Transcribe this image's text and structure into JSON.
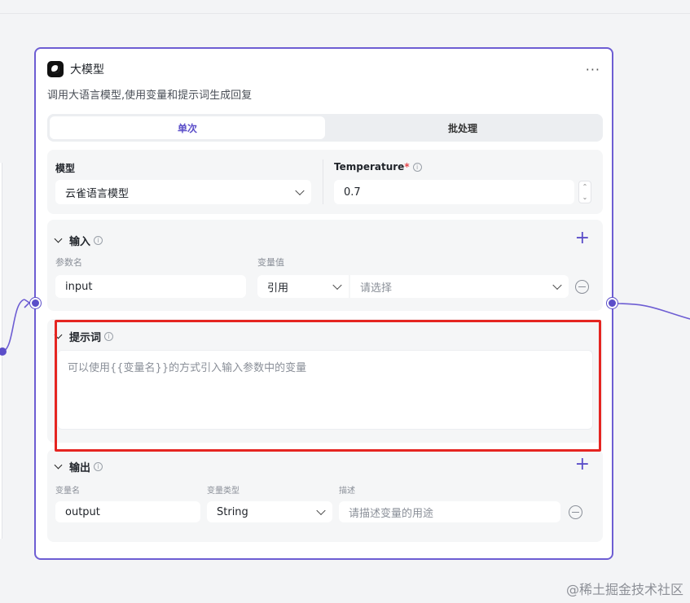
{
  "node": {
    "title": "大模型",
    "more_label": "···",
    "description": "调用大语言模型,使用变量和提示词生成回复",
    "tabs": [
      {
        "label": "单次",
        "active": true
      },
      {
        "label": "批处理",
        "active": false
      }
    ]
  },
  "model_section": {
    "model_label": "模型",
    "model_value": "云雀语言模型",
    "temperature_label": "Temperature",
    "required_mark": "*",
    "temperature_value": "0.7",
    "info_icon": "i"
  },
  "input_section": {
    "title": "输入",
    "add_label": "+",
    "param_name_header": "参数名",
    "var_value_header": "变量值",
    "rows": [
      {
        "name": "input",
        "source": "引用",
        "value_placeholder": "请选择"
      }
    ]
  },
  "prompt_section": {
    "title": "提示词",
    "placeholder": "可以使用{{变量名}}的方式引入输入参数中的变量"
  },
  "output_section": {
    "title": "输出",
    "add_label": "+",
    "var_name_header": "变量名",
    "var_type_header": "变量类型",
    "desc_header": "描述",
    "rows": [
      {
        "name": "output",
        "type": "String",
        "desc_placeholder": "请描述变量的用途"
      }
    ]
  },
  "watermark": "@稀土掘金技术社区",
  "colors": {
    "accent": "#5b4ec9",
    "node_border": "#6d5dd3",
    "highlight": "#e52521"
  }
}
